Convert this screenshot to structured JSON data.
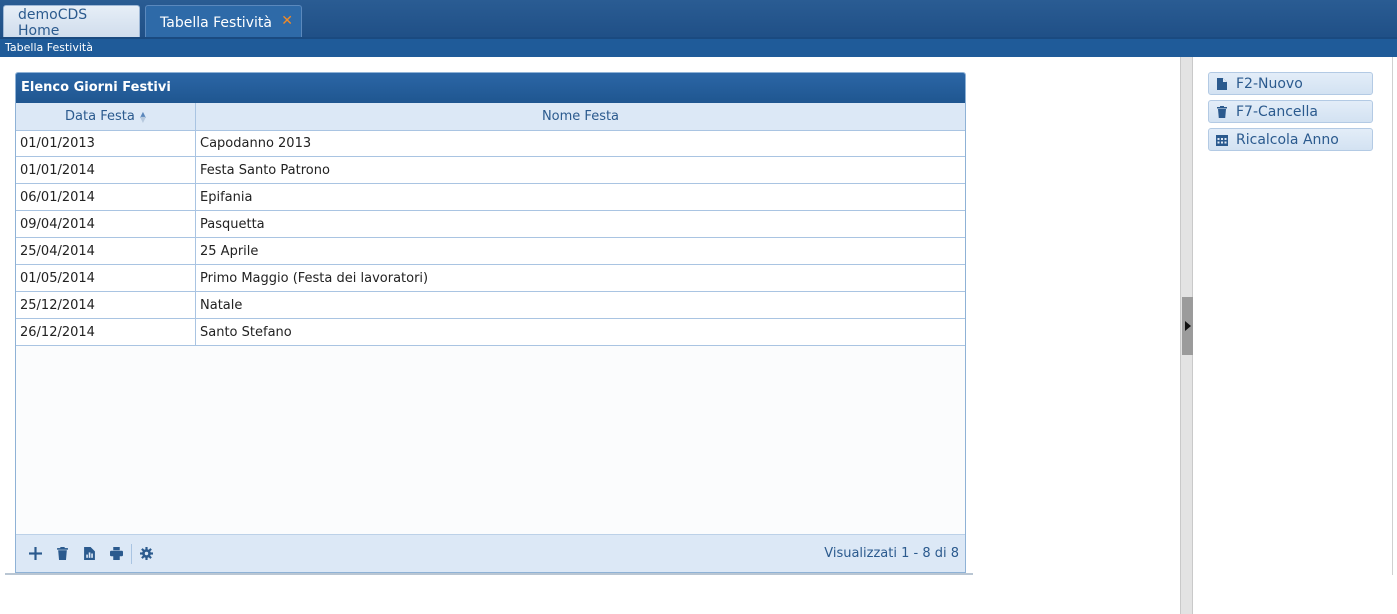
{
  "tabs": [
    {
      "label": "demoCDS Home",
      "active": false
    },
    {
      "label": "Tabella Festività",
      "active": true,
      "close": "✕"
    }
  ],
  "breadcrumb": "Tabella Festività",
  "grid": {
    "title": "Elenco Giorni Festivi",
    "columns": {
      "date": "Data Festa",
      "name": "Nome Festa"
    },
    "rows": [
      {
        "date": "01/01/2013",
        "name": "Capodanno 2013"
      },
      {
        "date": "01/01/2014",
        "name": "Festa Santo Patrono"
      },
      {
        "date": "06/01/2014",
        "name": "Epifania"
      },
      {
        "date": "09/04/2014",
        "name": "Pasquetta"
      },
      {
        "date": "25/04/2014",
        "name": "25 Aprile"
      },
      {
        "date": "01/05/2014",
        "name": "Primo Maggio (Festa dei lavoratori)"
      },
      {
        "date": "25/12/2014",
        "name": "Natale"
      },
      {
        "date": "26/12/2014",
        "name": "Santo Stefano"
      }
    ],
    "pager_info": "Visualizzati 1 - 8 di 8",
    "toolbar_icons": [
      "add-icon",
      "delete-icon",
      "export-icon",
      "print-icon",
      "settings-icon"
    ]
  },
  "actions": [
    {
      "label": "F2-Nuovo",
      "icon": "file-icon"
    },
    {
      "label": "F7-Cancella",
      "icon": "trash-icon"
    },
    {
      "label": "Ricalcola Anno",
      "icon": "calendar-icon"
    }
  ],
  "colors": {
    "header_blue": "#1f5690",
    "accent_orange": "#f28a26",
    "grid_header": "#dce8f6"
  }
}
